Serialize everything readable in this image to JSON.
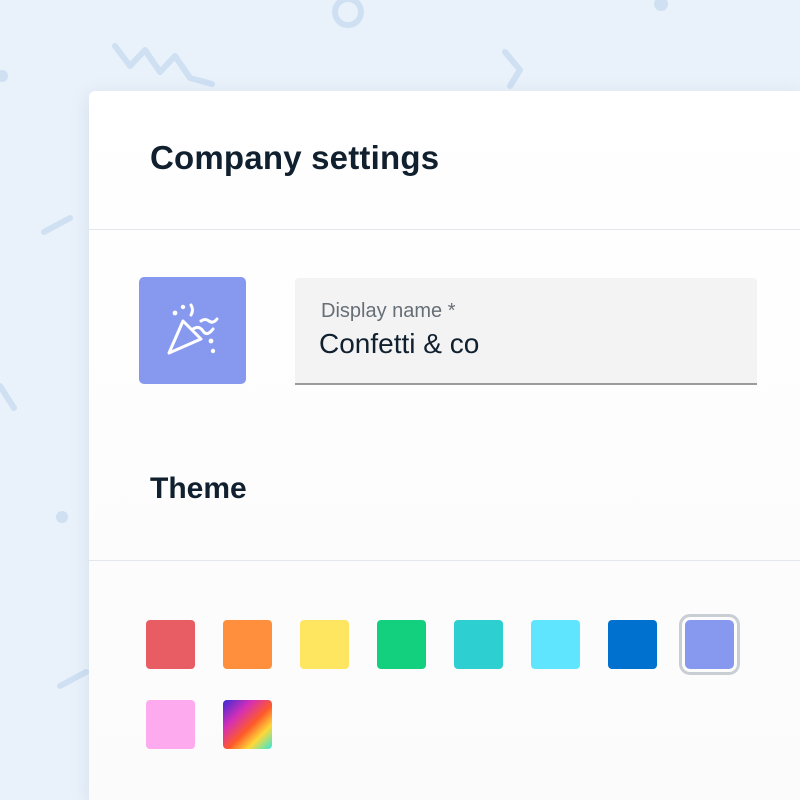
{
  "header": {
    "title": "Company settings"
  },
  "display_name": {
    "label": "Display name *",
    "value": "Confetti & co"
  },
  "logo": {
    "icon": "party-popper-icon",
    "color": "#8799ee"
  },
  "theme": {
    "title": "Theme",
    "selected_index": 7,
    "swatches": [
      {
        "name": "red",
        "color": "#e85d64"
      },
      {
        "name": "orange",
        "color": "#ff8f3d"
      },
      {
        "name": "yellow",
        "color": "#ffe661"
      },
      {
        "name": "green",
        "color": "#13d07e"
      },
      {
        "name": "teal",
        "color": "#2ecfd0"
      },
      {
        "name": "cyan",
        "color": "#5fe5fd"
      },
      {
        "name": "blue",
        "color": "#0071ce"
      },
      {
        "name": "periwinkle",
        "color": "#8799ee"
      },
      {
        "name": "pink",
        "color": "#fdaaee"
      },
      {
        "name": "rainbow",
        "color": "gradient"
      }
    ]
  }
}
